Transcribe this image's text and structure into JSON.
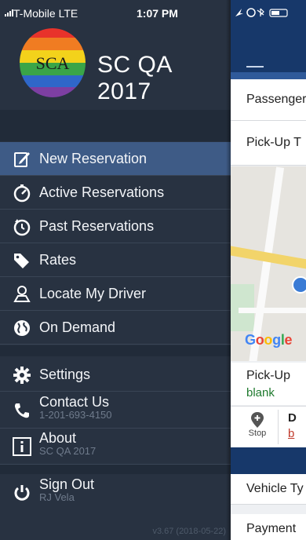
{
  "status": {
    "carrier": "T-Mobile  LTE",
    "time": "1:07 PM"
  },
  "brand": {
    "logo_text": "SCA",
    "app_name": "SC QA 2017"
  },
  "menu": {
    "items": [
      {
        "label": "New Reservation",
        "icon": "edit-icon",
        "selected": true
      },
      {
        "label": "Active Reservations",
        "icon": "timer-icon"
      },
      {
        "label": "Past Reservations",
        "icon": "history-icon"
      },
      {
        "label": "Rates",
        "icon": "tags-icon"
      },
      {
        "label": "Locate My Driver",
        "icon": "map-driver-icon"
      },
      {
        "label": "On Demand",
        "icon": "globe-icon"
      }
    ],
    "settings": {
      "label": "Settings",
      "icon": "gear-icon"
    },
    "contact": {
      "label": "Contact Us",
      "sub": "1-201-693-4150",
      "icon": "phone-icon"
    },
    "about": {
      "label": "About",
      "sub": "SC QA 2017",
      "icon": "info-icon"
    },
    "signout": {
      "label": "Sign Out",
      "sub": "RJ Vela",
      "icon": "power-icon"
    }
  },
  "version": "v3.67 (2018-05-22)",
  "main": {
    "passenger_label": "Passenger",
    "pickup_time_label": "Pick-Up T",
    "map_attribution": "Google",
    "pickup_label": "Pick-Up",
    "pickup_value": "blank",
    "stop_label": "Stop",
    "dropoff_initial": "D",
    "dropoff_value_initial": "b",
    "vehicle_label": "Vehicle Ty",
    "payment_label": "Payment"
  },
  "colors": {
    "drawer_bg": "#283241",
    "selected_bg": "#3e5b86",
    "header_blue": "#17386a",
    "pickup_green": "#1f7a2e",
    "dropoff_red": "#c0392b"
  }
}
